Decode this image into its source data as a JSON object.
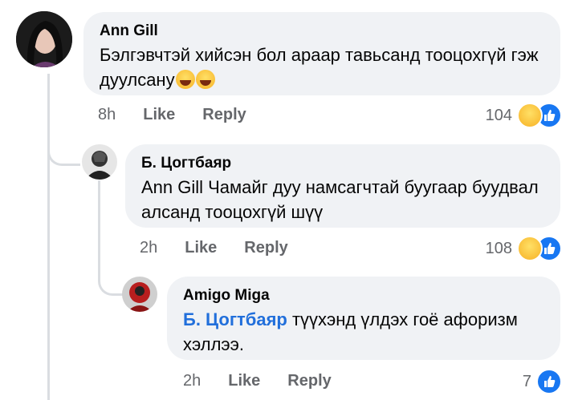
{
  "comments": [
    {
      "author": "Ann Gill",
      "text": "Бэлгэвчтэй хийсэн бол араар тавьсанд тооцохгүй гэж дуулсану",
      "time": "8h",
      "like_label": "Like",
      "reply_label": "Reply",
      "reaction_count": "104",
      "reaction_icons": [
        "haha-icon",
        "like-icon"
      ]
    },
    {
      "author": "Б. Цогтбаяр",
      "text": "Ann Gill Чамайг дуу намсагчтай буугаар буудвал алсанд тооцохгүй шүү",
      "time": "2h",
      "like_label": "Like",
      "reply_label": "Reply",
      "reaction_count": "108",
      "reaction_icons": [
        "haha-icon",
        "like-icon"
      ]
    },
    {
      "author": "Amigo Miga",
      "mention": "Б. Цогтбаяр",
      "text": "түүхэнд үлдэх гоё афоризм хэллээ.",
      "time": "2h",
      "like_label": "Like",
      "reply_label": "Reply",
      "reaction_count": "7",
      "reaction_icons": [
        "like-icon"
      ]
    }
  ],
  "colors": {
    "bubble": "#f0f2f5",
    "meta": "#65676b",
    "mention": "#216fdb",
    "like_blue": "#1877f2",
    "haha_yellow": "#f7b125"
  }
}
